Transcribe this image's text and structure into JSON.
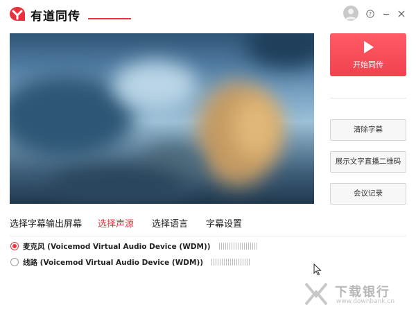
{
  "app": {
    "title": "有道同传",
    "logo_icon": "youdao-cloud-logo",
    "brand_color": "#e8333f"
  },
  "window_controls": {
    "avatar_icon": "user-avatar-icon",
    "help": "?",
    "minimize": "–",
    "close": "✕"
  },
  "preview": {
    "icon": "video-preview-blurred"
  },
  "start_button": {
    "label": "开始同传",
    "icon": "play-icon"
  },
  "side_buttons": [
    {
      "label": "清除字幕"
    },
    {
      "label": "展示文字直播二维码"
    },
    {
      "label": "会议记录"
    }
  ],
  "tabs": [
    {
      "label": "选择字幕输出屏幕",
      "active": false
    },
    {
      "label": "选择声源",
      "active": true
    },
    {
      "label": "选择语言",
      "active": false
    },
    {
      "label": "字幕设置",
      "active": false
    }
  ],
  "audio_sources": [
    {
      "label": "麦克风 (Voicemod Virtual Audio Device (WDM))",
      "selected": true,
      "level": 0
    },
    {
      "label": "线路 (Voicemod Virtual Audio Device (WDM))",
      "selected": false,
      "level": 0
    }
  ],
  "watermark": {
    "name": "下载银行",
    "url": "www.downbank.cn"
  }
}
